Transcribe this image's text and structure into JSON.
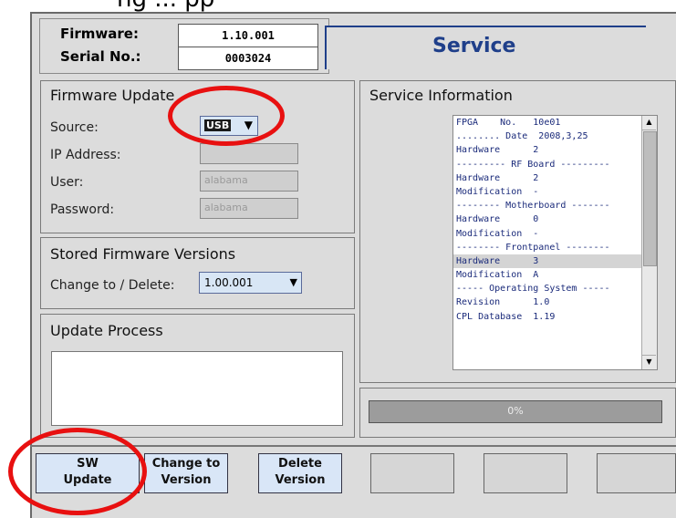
{
  "page_top_text": "ng ... pp",
  "header": {
    "firmware_label": "Firmware:",
    "firmware_value": "1.10.001",
    "serial_label": "Serial No.:",
    "serial_value": "0003024",
    "service_tab": "Service"
  },
  "firmware_update": {
    "title": "Firmware Update",
    "source_label": "Source:",
    "source_value": "USB",
    "ip_label": "IP Address:",
    "ip_value": "",
    "user_label": "User:",
    "user_placeholder": "alabama",
    "password_label": "Password:",
    "password_placeholder": "alabama"
  },
  "stored_versions": {
    "title": "Stored Firmware Versions",
    "change_label": "Change to / Delete:",
    "change_value": "1.00.001"
  },
  "update_process": {
    "title": "Update Process"
  },
  "service_info": {
    "title": "Service Information",
    "lines": [
      "FPGA    No.   10e01",
      "........ Date  2008,3,25",
      "Hardware      2",
      "--------- RF Board ---------",
      "Hardware      2",
      "Modification  -",
      "-------- Motherboard -------",
      "Hardware      0",
      "Modification  -",
      "-------- Frontpanel --------",
      "Hardware      3",
      "Modification  A",
      "----- Operating System -----",
      "Revision      1.0",
      "CPL Database  1.19"
    ],
    "selected_index": 10
  },
  "progress": {
    "text": "0%",
    "value": 0
  },
  "buttons": {
    "sw_update_line1": "SW",
    "sw_update_line2": "Update",
    "change_line1": "Change to",
    "change_line2": "Version",
    "delete_line1": "Delete",
    "delete_line2": "Version"
  },
  "colors": {
    "accent": "#1f3f8a",
    "annotation": "#e81010"
  }
}
